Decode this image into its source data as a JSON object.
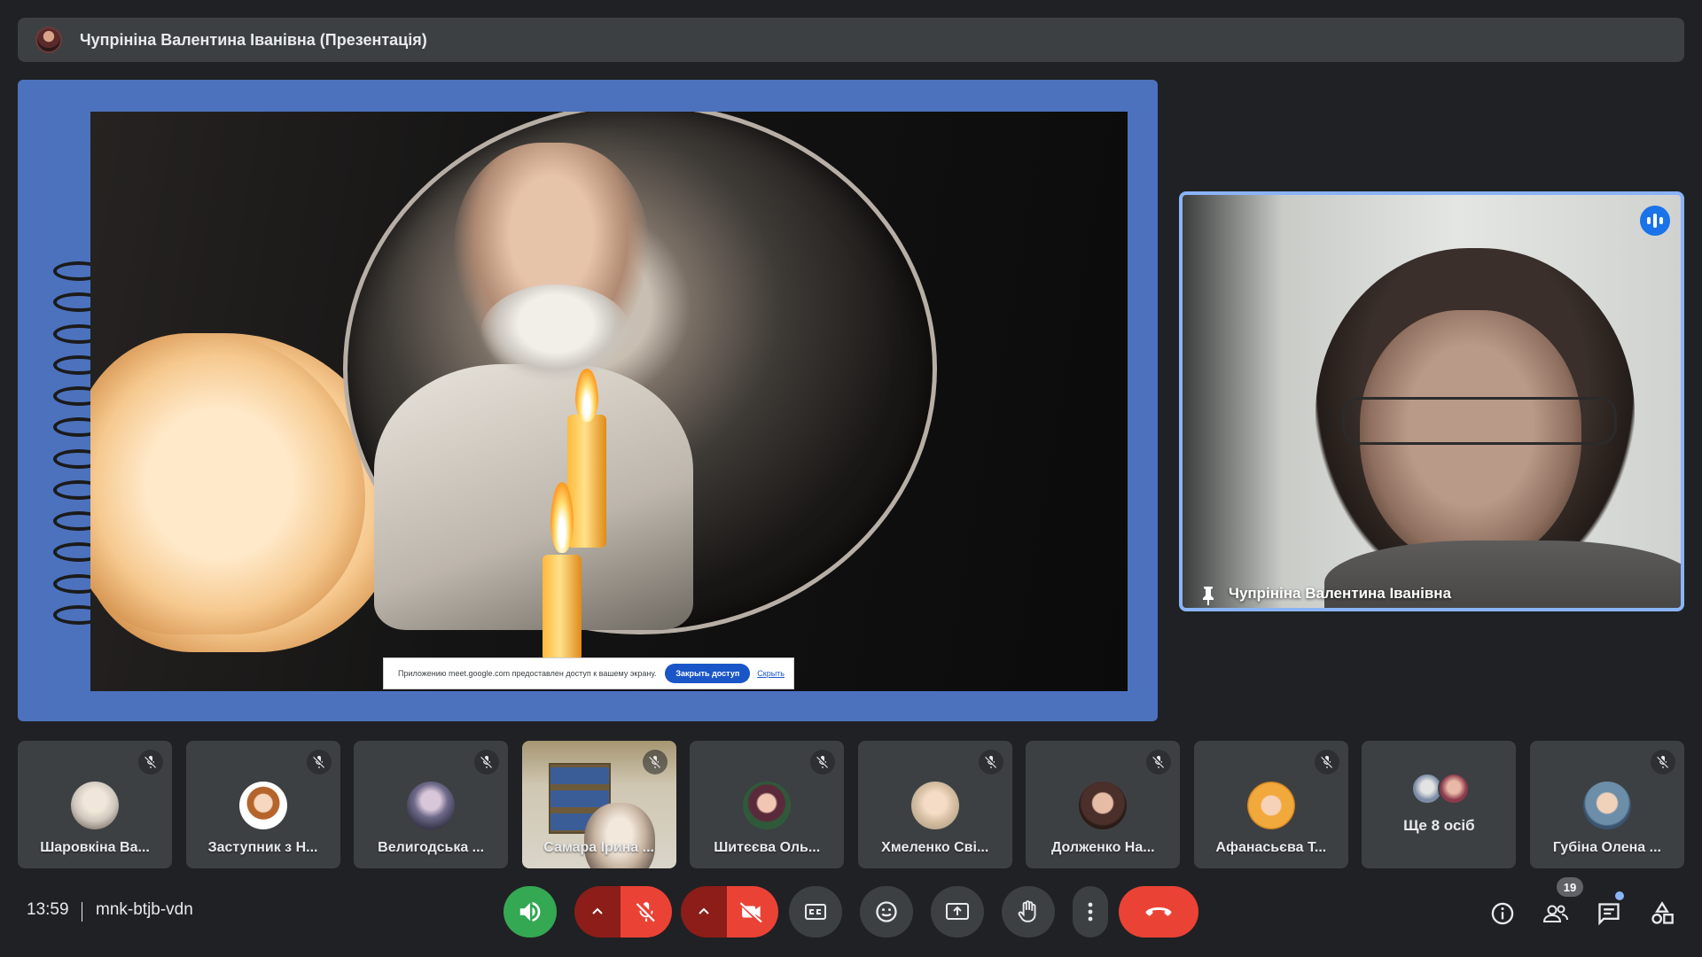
{
  "presenter_bar": {
    "title": "Чупрініна Валентина Іванівна (Презентація)"
  },
  "presentation": {
    "share_notice_text": "Приложению meet.google.com предоставлен доступ к вашему экрану.",
    "share_stop_label": "Закрыть доступ",
    "share_hide_label": "Скрыть"
  },
  "speaker": {
    "name": "Чупрініна Валентина Іванівна"
  },
  "participants": [
    {
      "name": "Шаровкіна Ва...",
      "avatar_color": "#cfc7bd",
      "muted": true
    },
    {
      "name": "Заступник з Н...",
      "avatar_color": "#f4f4f4",
      "muted": true
    },
    {
      "name": "Велигодська ...",
      "avatar_color": "#4a4d63",
      "muted": true
    },
    {
      "name": "Самара Ірина ...",
      "muted": true,
      "video": true
    },
    {
      "name": "Шитєєва Оль...",
      "avatar_color": "#2f5a3a",
      "muted": true
    },
    {
      "name": "Хмеленко Сві...",
      "avatar_color": "#d9c2a6",
      "muted": true
    },
    {
      "name": "Долженко На...",
      "avatar_color": "#4a2f2a",
      "muted": true
    },
    {
      "name": "Афанасьєва Т...",
      "avatar_color": "#f2a93b",
      "muted": true
    },
    {
      "name": "Губіна Олена ...",
      "avatar_color": "#6d8ea8",
      "muted": true
    }
  ],
  "more_tile": {
    "label": "Ще 8 осіб"
  },
  "footer": {
    "time": "13:59",
    "meeting_code": "mnk-btjb-vdn",
    "participant_count": "19"
  },
  "colors": {
    "background": "#202124",
    "tile": "#3c4043",
    "accent_blue": "#8ab4f8",
    "danger_red": "#ea4335",
    "audio_green": "#34a853",
    "stage_blue": "#4c72bd"
  }
}
